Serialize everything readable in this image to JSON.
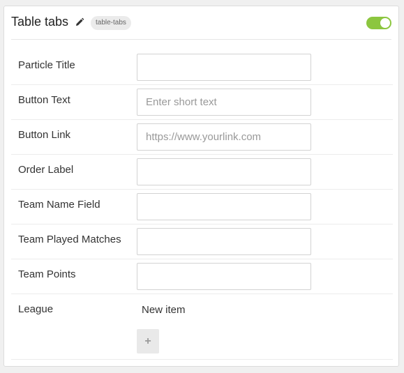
{
  "header": {
    "title": "Table tabs",
    "tag": "table-tabs",
    "edit_icon": "pencil-icon",
    "toggle_enabled": true,
    "toggle_color": "#8cc63f"
  },
  "fields": [
    {
      "label": "Particle Title",
      "value": "",
      "placeholder": ""
    },
    {
      "label": "Button Text",
      "value": "",
      "placeholder": "Enter short text"
    },
    {
      "label": "Button Link",
      "value": "",
      "placeholder": "https://www.yourlink.com"
    },
    {
      "label": "Order Label",
      "value": "",
      "placeholder": ""
    },
    {
      "label": "Team Name Field",
      "value": "",
      "placeholder": ""
    },
    {
      "label": "Team Played Matches",
      "value": "",
      "placeholder": ""
    },
    {
      "label": "Team Points",
      "value": "",
      "placeholder": ""
    }
  ],
  "league": {
    "label": "League",
    "items": [
      "New item"
    ],
    "add_button_label": "+",
    "add_icon": "plus-icon"
  }
}
